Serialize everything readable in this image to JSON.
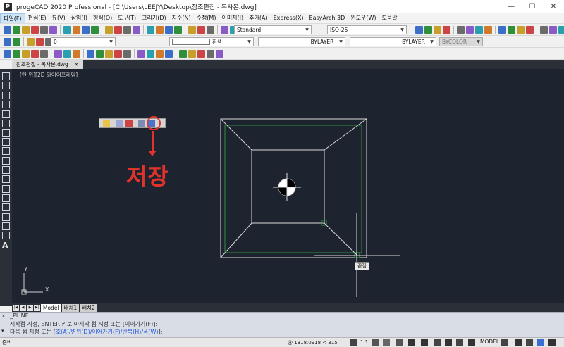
{
  "window": {
    "title": "progeCAD 2020 Professional - [C:\\Users\\LEEJY\\Desktop\\참조편집 - 복사본.dwg]",
    "app_icon": "P"
  },
  "menu": {
    "items": [
      "파일(F)",
      "편집(E)",
      "뷰(V)",
      "삽입(I)",
      "형식(O)",
      "도구(T)",
      "그리기(D)",
      "치수(N)",
      "수정(M)",
      "이미지(I)",
      "추가(A)",
      "Express(X)",
      "EasyArch 3D",
      "윈도우(W)",
      "도움말"
    ]
  },
  "toolbar": {
    "text_style": "Standard",
    "dim_style": "ISO-25",
    "layer": "0",
    "color": "흰색",
    "linetype": "BYLAYER",
    "lineweight": "BYLAYER",
    "plotstyle": "BYCOLOR"
  },
  "document": {
    "tab_label": "참조편집 - 복사본.dwg",
    "tab_close": "×",
    "view_label": "[맨 위][2D 와이어프레임]"
  },
  "annotation": {
    "save_label": "저장",
    "color": "#e0342b"
  },
  "drawing": {
    "snap_tooltip": "끝점",
    "ucs_x": "X",
    "ucs_y": "Y"
  },
  "layout_tabs": {
    "nav": [
      "|◀",
      "◀",
      "▶",
      "▶|"
    ],
    "tabs": [
      "Model",
      "배치1",
      "배치2"
    ],
    "active": "Model"
  },
  "command": {
    "line1": "_PLINE",
    "line2": "시작점 지정, ENTER 키로 마지막 점 지정 또는 [이어가기(F)]:",
    "line3_prefix": "다음 점 지정 또는 [",
    "line3_opts": "호(A)/변위(D)/이어가기(F)/반복(H)/폭(W)",
    "line3_suffix": "]:",
    "close_glyph": "×",
    "expand_glyph": "▾"
  },
  "status": {
    "ready": "준비",
    "coords": "@ 1318.0918 < 315",
    "model": "MODEL",
    "scale": "1:1"
  },
  "colors": {
    "canvas_bg": "#1e2330",
    "panel_bg": "#2b2f38",
    "drawing_line": "#d9d9d9",
    "green_line": "#2f8f3a"
  }
}
